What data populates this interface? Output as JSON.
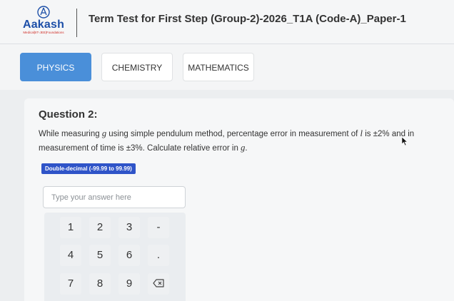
{
  "brand": {
    "name": "Aakash",
    "tagline": "Medical|IIT-JEE|Foundations"
  },
  "header": {
    "test_title": "Term Test for First Step (Group-2)-2026_T1A (Code-A)_Paper-1"
  },
  "subjects": [
    {
      "label": "PHYSICS",
      "active": true
    },
    {
      "label": "CHEMISTRY",
      "active": false
    },
    {
      "label": "MATHEMATICS",
      "active": false
    }
  ],
  "question": {
    "title": "Question 2:",
    "text_1": "While measuring ",
    "var_g": "g",
    "text_2": " using simple pendulum method, percentage error in measurement of ",
    "var_l": "l",
    "text_3": " is ±2% and in measurement of time is ±3%. Calculate relative error in ",
    "var_g2": "g",
    "text_4": ".",
    "answer_type_badge": "Double-decimal (-99.99 to 99.99)"
  },
  "answer_input": {
    "value": "",
    "placeholder": "Type your answer here"
  },
  "keypad": {
    "keys": [
      "1",
      "2",
      "3",
      "-",
      "4",
      "5",
      "6",
      ".",
      "7",
      "8",
      "9"
    ],
    "backspace_icon": "backspace-icon"
  },
  "colors": {
    "accent": "#4a8fd9",
    "badge": "#2f54c8",
    "brand_blue": "#1d4fa8",
    "brand_red": "#d0302a"
  }
}
